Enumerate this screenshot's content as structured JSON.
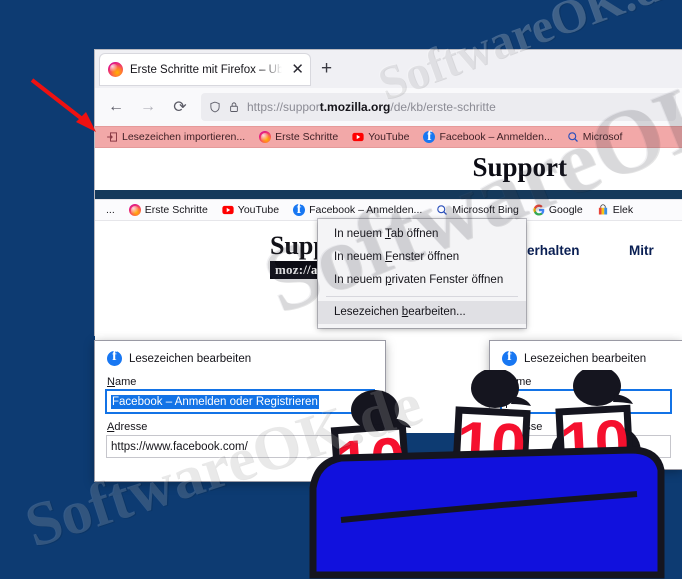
{
  "watermark": {
    "main": "SoftwareOK.de",
    "corner": "SoftwareOK.de",
    "center": "SoftwareOK"
  },
  "browser": {
    "tab": {
      "title": "Erste Schritte mit Firefox – Überb",
      "close_label": "✕",
      "favicon": "firefox-icon"
    },
    "newtab_label": "+",
    "nav": {
      "back": "←",
      "forward": "→",
      "reload": "⟳"
    },
    "urlbar": {
      "shield_icon": "shield-icon",
      "lock_icon": "lock-icon",
      "url_prefix": "https://suppor",
      "url_bold": "t.mozilla.org",
      "url_suffix": "/de/kb/erste-schritte"
    },
    "bookmarks_highlighted": [
      {
        "label": "Lesezeichen importieren...",
        "icon": "import-bookmarks-icon"
      },
      {
        "label": "Erste Schritte",
        "icon": "firefox-icon"
      },
      {
        "label": "YouTube",
        "icon": "youtube-icon"
      },
      {
        "label": "Facebook – Anmelden...",
        "icon": "facebook-icon"
      },
      {
        "label": "Microsof",
        "icon": "search-icon"
      }
    ],
    "bookmarks_plain": [
      {
        "label": "...",
        "icon": "ellipsis-icon"
      },
      {
        "label": "Erste Schritte",
        "icon": "firefox-icon"
      },
      {
        "label": "YouTube",
        "icon": "youtube-icon"
      },
      {
        "label": "Facebook – Anmelden...",
        "icon": "facebook-icon"
      },
      {
        "label": "Microsoft Bing",
        "icon": "search-icon"
      },
      {
        "label": "Google",
        "icon": "google-icon"
      },
      {
        "label": "Elek",
        "icon": "shopping-bag-icon"
      }
    ]
  },
  "page": {
    "support_heading": "Support",
    "logo_word": "Supp",
    "logo_tag": "moz://a",
    "nav_links": [
      "erhalten",
      "Mitr"
    ]
  },
  "context_menu": {
    "items": [
      {
        "pre": "In neuem ",
        "key": "T",
        "post": "ab öffnen"
      },
      {
        "pre": "In neuem ",
        "key": "F",
        "post": "enster öffnen"
      },
      {
        "pre": "In neuem ",
        "key": "p",
        "post": "rivaten Fenster öffnen"
      }
    ],
    "highlighted": {
      "pre": "Lesezeichen ",
      "key": "b",
      "post": "earbeiten..."
    }
  },
  "dialog_left": {
    "title": "Lesezeichen bearbeiten",
    "icon": "facebook-icon",
    "name_label_key": "N",
    "name_label_rest": "ame",
    "name_value": "Facebook – Anmelden oder Registrieren",
    "address_label_key": "A",
    "address_label_rest": "dresse",
    "address_value": "https://www.facebook.com/"
  },
  "dialog_right": {
    "title": "Lesezeichen bearbeiten",
    "icon": "facebook-icon",
    "name_label_key": "N",
    "name_label_rest": "ame",
    "name_value": "",
    "address_label_key": "A",
    "address_label_rest": "dresse",
    "address_value": ""
  },
  "annotation": {
    "arrow": "red-arrow",
    "arrow_color": "#ee1111"
  },
  "figures": {
    "count": 3,
    "sign_text": "10",
    "sign_color": "#f5102e",
    "table_color": "#1111dd"
  }
}
